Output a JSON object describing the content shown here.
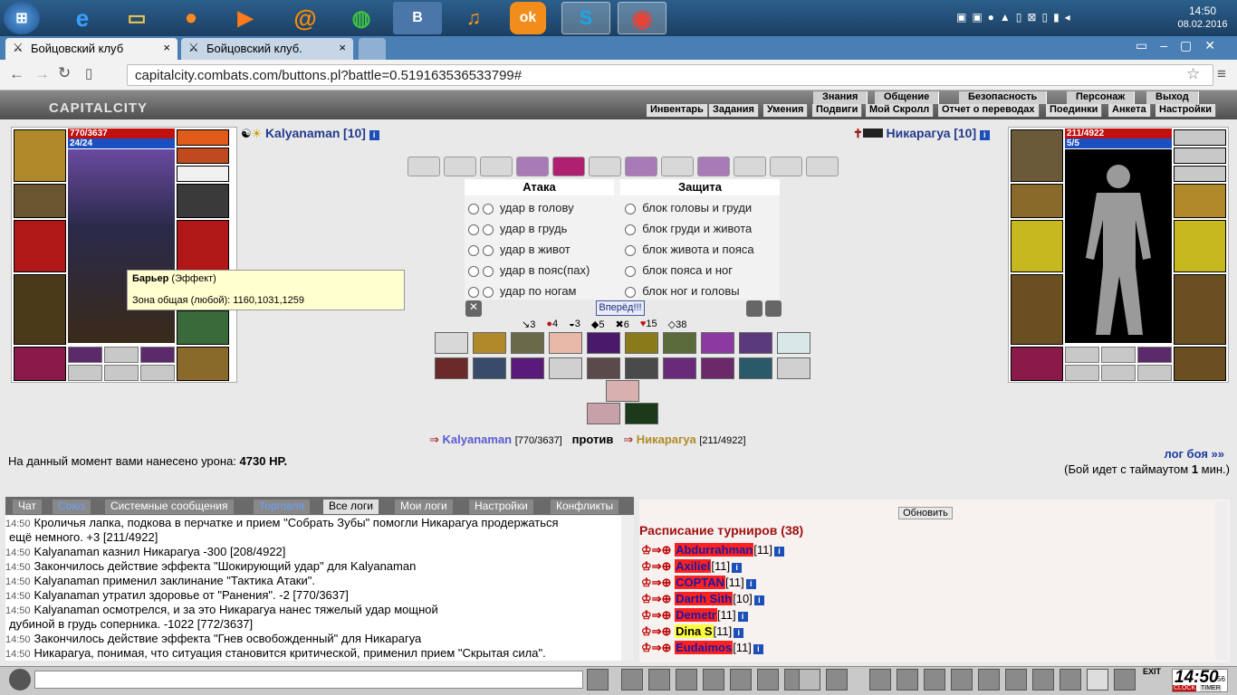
{
  "taskbar": {
    "clock_time": "14:50",
    "clock_date": "08.02.2016",
    "apps": [
      "ie",
      "explorer",
      "firefox",
      "media",
      "mail",
      "globe",
      "vk",
      "music",
      "ok",
      "skype",
      "chrome"
    ]
  },
  "browser": {
    "tabs": [
      {
        "label": "Бойцовский клуб"
      },
      {
        "label": "Бойцовский клуб."
      }
    ],
    "url": "capitalcity.combats.com/buttons.pl?battle=0.519163536533799#"
  },
  "game_header": {
    "logo": "CAPITALCITY",
    "menu_top": [
      "Знания",
      "Общение",
      "Безопасность",
      "Персонаж",
      "Выход"
    ],
    "menu_bottom": [
      "Инвентарь",
      "Задания",
      "Умения",
      "Подвиги",
      "Мой Скролл",
      "Отчет о переводах",
      "Поединки",
      "Анкета",
      "Настройки"
    ]
  },
  "left_player": {
    "hp": "770/3637",
    "mana": "24/24",
    "name": "Kalyanaman",
    "level": "[10]"
  },
  "right_player": {
    "hp": "211/4922",
    "mana": "5/5",
    "name": "Никарагуа",
    "level": "[10]"
  },
  "attack": {
    "title": "Атака",
    "options": [
      "удар в голову",
      "удар в грудь",
      "удар в живот",
      "удар в пояс(пах)",
      "удар по ногам"
    ]
  },
  "defense": {
    "title": "Защита",
    "options": [
      "блок головы и груди",
      "блок груди и живота",
      "блок живота и пояса",
      "блок пояса и ног",
      "блок ног и головы"
    ]
  },
  "go_button": "Вперёд!!!",
  "stats": [
    "3",
    "4",
    "3",
    "5",
    "6",
    "15",
    "38"
  ],
  "tooltip": {
    "title": "Барьер",
    "title_suffix": " (Эффект)",
    "body": "Зона общая (любой): 1160,1031,1259"
  },
  "vs": {
    "left": "Kalyanaman",
    "left_hp": "[770/3637]",
    "versus": "против",
    "right": "Никарагуа",
    "right_hp": "[211/4922]"
  },
  "damage": {
    "label": "На данный момент вами нанесено урона: ",
    "value": "4730 HP."
  },
  "battle_log_link": "лог боя »»",
  "timeout": {
    "prefix": "(Бой идет с таймаутом ",
    "value": "1",
    "suffix": " мин.)"
  },
  "chat_tabs": [
    "Чат",
    "Союз",
    "Системные сообщения",
    "Торговля",
    "Все логи",
    "Мои логи",
    "Настройки",
    "Конфликты"
  ],
  "chat_lines": [
    {
      "time": "14:50",
      "text": "Кроличья лапка, подкова в перчатке и прием \"Собрать Зубы\" помогли Никарагуа продержаться"
    },
    {
      "time": "",
      "text": "ещё немного. +3 [211/4922]"
    },
    {
      "time": "14:50",
      "text": "Kalyanaman казнил Никарагуа -300 [208/4922]"
    },
    {
      "time": "14:50",
      "text": "Закончилось действие эффекта \"Шокирующий удар\" для Kalyanaman"
    },
    {
      "time": "14:50",
      "text": "Kalyanaman применил заклинание \"Тактика Атаки\"."
    },
    {
      "time": "14:50",
      "text": "Kalyanaman утратил здоровье от \"Ранения\". -2 [770/3637]"
    },
    {
      "time": "14:50",
      "text": "Kalyanaman осмотрелся, и за это Никарагуа нанес тяжелый удар мощной"
    },
    {
      "time": "",
      "text": "дубиной в грудь соперника. -1022 [772/3637]"
    },
    {
      "time": "14:50",
      "text": "Закончилось действие эффекта \"Гнев освобожденный\" для Никарагуа"
    },
    {
      "time": "14:50",
      "text": "Никарагуа, понимая, что ситуация становится критической, применил прием \"Скрытая сила\"."
    }
  ],
  "tourney": {
    "refresh": "Обновить",
    "title": "Расписание турниров (38)",
    "players": [
      {
        "name": "Abdurrahman",
        "level": "[11]"
      },
      {
        "name": "Axiliel",
        "level": "[11]"
      },
      {
        "name": "COPTAN",
        "level": "[11]"
      },
      {
        "name": "Darth Sith",
        "level": "[10]"
      },
      {
        "name": "Demetr",
        "level": "[11]"
      },
      {
        "name": "Dina S",
        "level": "[11]"
      },
      {
        "name": "Eudaimos",
        "level": "[11]"
      }
    ]
  },
  "bottom": {
    "clock": "14:50",
    "seconds": "56",
    "clock_label": "CLOCK",
    "timer_label": "TIMER",
    "exit": "EXIT"
  }
}
